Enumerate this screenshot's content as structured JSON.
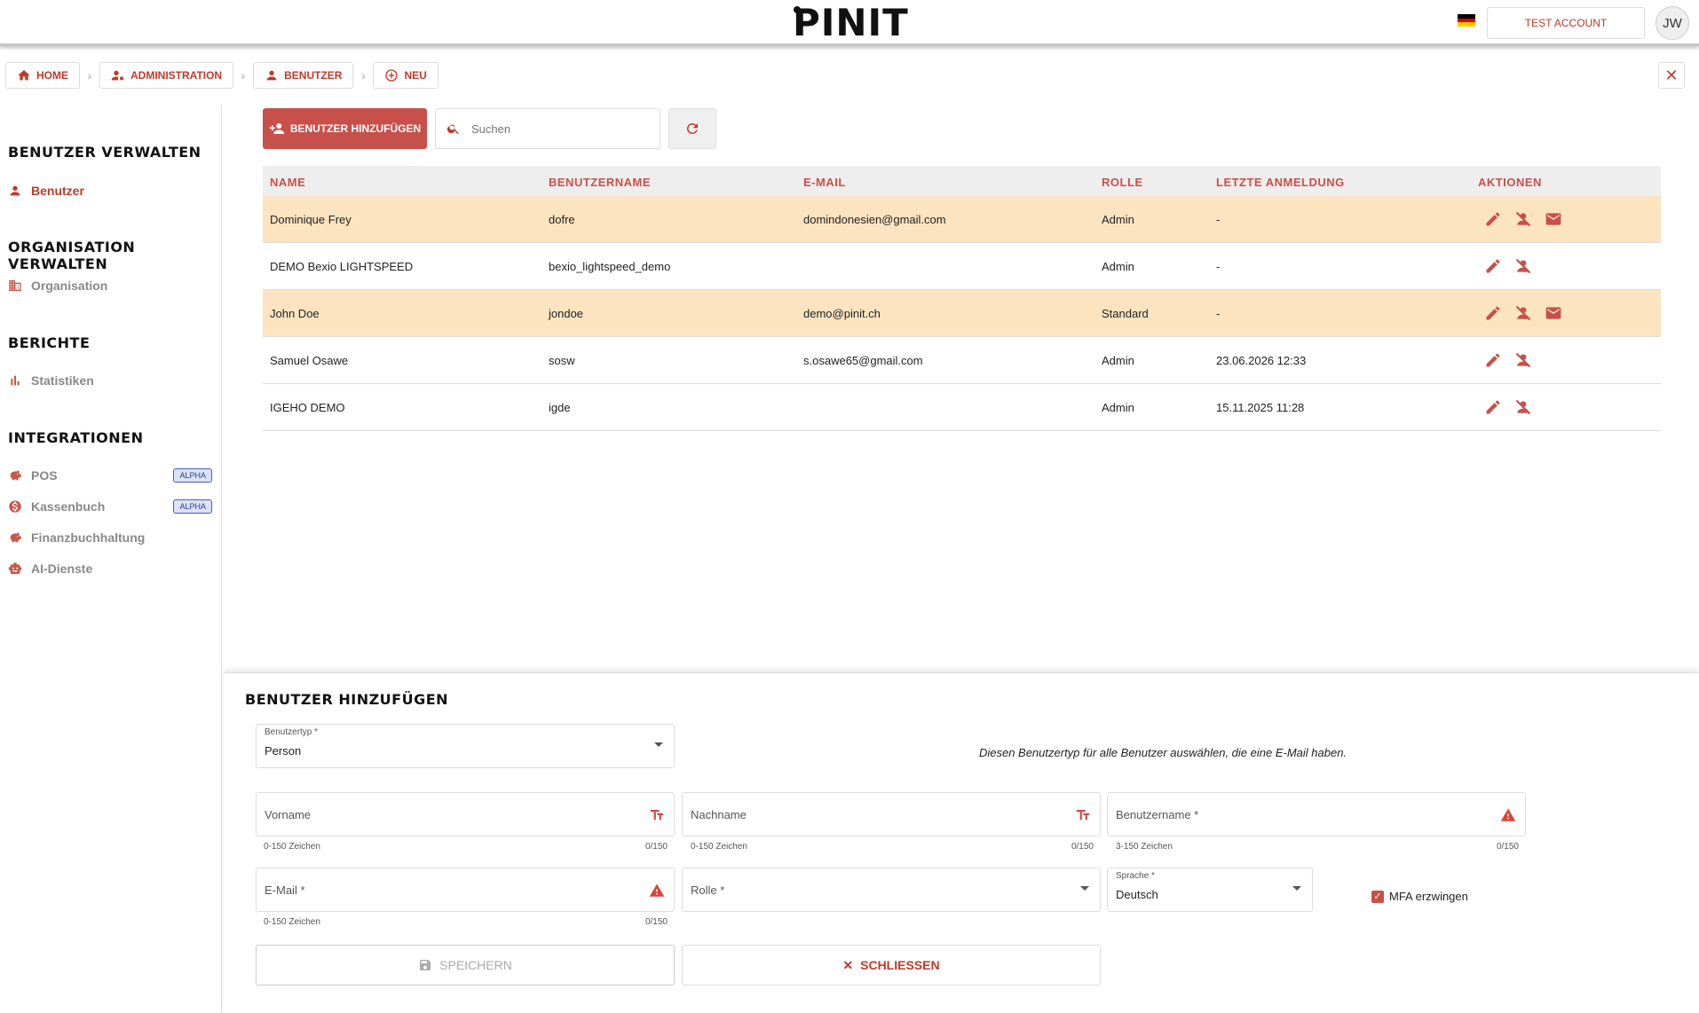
{
  "header": {
    "logo_text": "PINIT",
    "account_label": "TEST ACCOUNT",
    "avatar_initials": "JW",
    "flag_colors": [
      "#000000",
      "#dd0000",
      "#ffce00"
    ]
  },
  "breadcrumb": [
    {
      "label": "HOME",
      "icon": "home-icon"
    },
    {
      "label": "ADMINISTRATION",
      "icon": "user-gear-icon"
    },
    {
      "label": "BENUTZER",
      "icon": "user-icon"
    },
    {
      "label": "NEU",
      "icon": "plus-circle-icon"
    }
  ],
  "sidebar": {
    "sections": [
      {
        "heading": "BENUTZER VERWALTEN",
        "items": [
          {
            "label": "Benutzer",
            "icon": "user-icon",
            "active": true
          }
        ]
      },
      {
        "heading": "ORGANISATION VERWALTEN",
        "items": [
          {
            "label": "Organisation",
            "icon": "building-icon"
          }
        ]
      },
      {
        "heading": "BERICHTE",
        "items": [
          {
            "label": "Statistiken",
            "icon": "bar-chart-icon"
          }
        ]
      },
      {
        "heading": "INTEGRATIONEN",
        "items": [
          {
            "label": "POS",
            "icon": "piggy-bank-icon",
            "badge": "ALPHA"
          },
          {
            "label": "Kassenbuch",
            "icon": "dollar-icon",
            "badge": "ALPHA"
          },
          {
            "label": "Finanzbuchhaltung",
            "icon": "piggy-bank-icon"
          },
          {
            "label": "AI-Dienste",
            "icon": "robot-icon"
          }
        ]
      }
    ]
  },
  "toolbar": {
    "add_button_label": "BENUTZER HINZUFÜGEN",
    "search_placeholder": "Suchen"
  },
  "table": {
    "columns": [
      "NAME",
      "BENUTZERNAME",
      "E-MAIL",
      "ROLLE",
      "LETZTE ANMELDUNG",
      "AKTIONEN"
    ],
    "rows": [
      {
        "name": "Dominique Frey",
        "username": "dofre",
        "email": "domindonesien@gmail.com",
        "role": "Admin",
        "last_login": "-",
        "highlighted": true,
        "has_mail": true
      },
      {
        "name": "DEMO Bexio LIGHTSPEED",
        "username": "bexio_lightspeed_demo",
        "email": "",
        "role": "Admin",
        "last_login": "-",
        "highlighted": false,
        "has_mail": false
      },
      {
        "name": "John Doe",
        "username": "jondoe",
        "email": "demo@pinit.ch",
        "role": "Standard",
        "last_login": "-",
        "highlighted": true,
        "has_mail": true
      },
      {
        "name": "Samuel Osawe",
        "username": "sosw",
        "email": "s.osawe65@gmail.com",
        "role": "Admin",
        "last_login": "23.06.2026 12:33",
        "highlighted": false,
        "has_mail": false
      },
      {
        "name": "IGEHO DEMO",
        "username": "igde",
        "email": "",
        "role": "Admin",
        "last_login": "15.11.2025 11:28",
        "highlighted": false,
        "has_mail": false
      }
    ]
  },
  "form": {
    "title": "BENUTZER HINZUFÜGEN",
    "user_type": {
      "label": "Benutzertyp *",
      "value": "Person"
    },
    "user_type_description": "Diesen Benutzertyp für alle Benutzer auswählen, die eine E-Mail haben.",
    "first_name": {
      "placeholder": "Vorname",
      "hint": "0-150 Zeichen",
      "counter": "0/150"
    },
    "last_name": {
      "placeholder": "Nachname",
      "hint": "0-150 Zeichen",
      "counter": "0/150"
    },
    "username": {
      "placeholder": "Benutzername *",
      "hint": "3-150 Zeichen",
      "counter": "0/150"
    },
    "email": {
      "placeholder": "E-Mail *",
      "hint": "0-150 Zeichen",
      "counter": "0/150"
    },
    "role": {
      "placeholder": "Rolle *"
    },
    "language": {
      "label": "Sprache *",
      "value": "Deutsch"
    },
    "mfa_label": "MFA erzwingen",
    "mfa_checked": true,
    "save_label": "SPEICHERN",
    "close_label": "SCHLIESSEN"
  },
  "colors": {
    "accent": "#c8504a",
    "highlight_row": "#fde4c0",
    "badge_bg": "#dbe2f6"
  }
}
